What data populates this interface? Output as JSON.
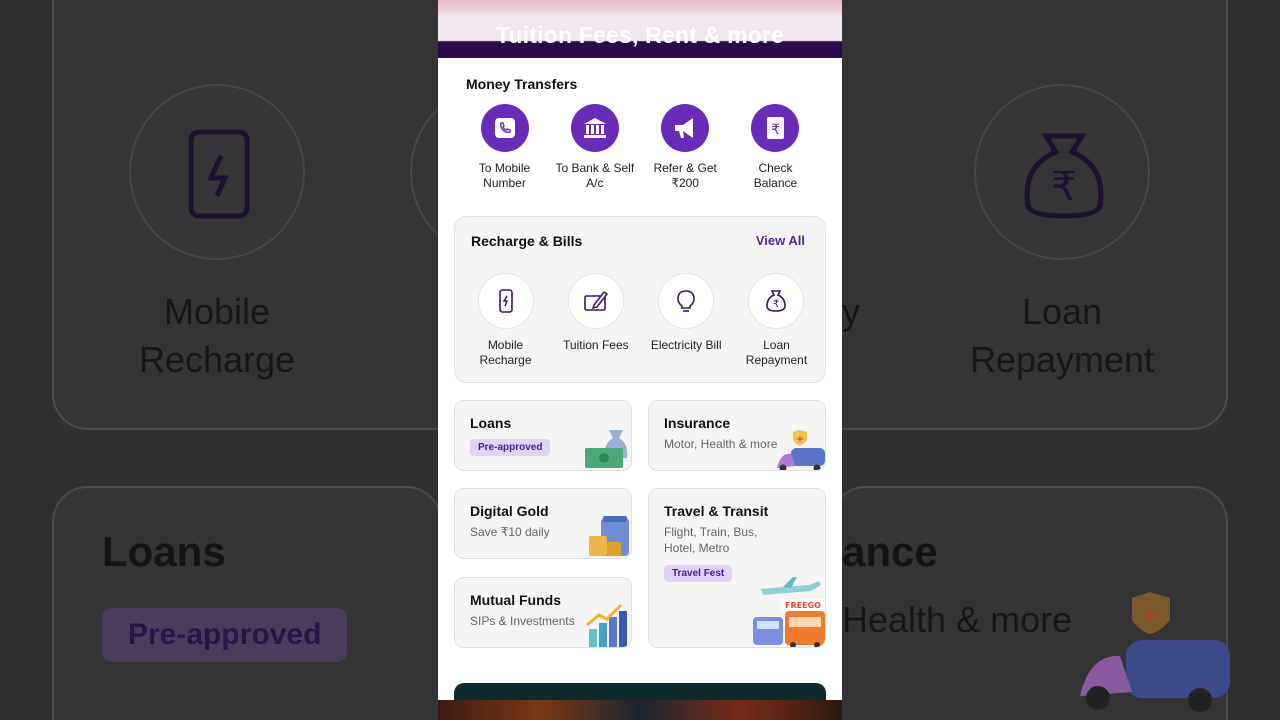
{
  "background": {
    "mobile_recharge_label": "Mobile Recharge",
    "loan_repayment_label": "Loan Repayment",
    "partial_label": "y",
    "loans_label": "Loans",
    "preapproved_label": "Pre-approved",
    "insurance_partial": "ance",
    "insurance_sub_partial": "Health & more"
  },
  "banner": {
    "title": "Tuition Fees, Rent & more"
  },
  "money_transfers": {
    "title": "Money Transfers",
    "items": [
      {
        "label": "To Mobile Number",
        "icon": "phone-icon"
      },
      {
        "label": "To Bank & Self A/c",
        "icon": "bank-icon"
      },
      {
        "label": "Refer & Get ₹200",
        "icon": "megaphone-icon"
      },
      {
        "label": "Check Balance",
        "icon": "rupee-book-icon"
      }
    ]
  },
  "recharge_bills": {
    "title": "Recharge & Bills",
    "view_all": "View All",
    "items": [
      {
        "label": "Mobile Recharge",
        "icon": "mobile-charge-icon"
      },
      {
        "label": "Tuition Fees",
        "icon": "tuition-icon"
      },
      {
        "label": "Electricity Bill",
        "icon": "bulb-icon"
      },
      {
        "label": "Loan Repayment",
        "icon": "money-bag-icon"
      }
    ]
  },
  "tiles": {
    "loans": {
      "title": "Loans",
      "badge": "Pre-approved"
    },
    "insurance": {
      "title": "Insurance",
      "subtitle": "Motor, Health & more"
    },
    "digital_gold": {
      "title": "Digital Gold",
      "subtitle": "Save ₹10 daily"
    },
    "travel": {
      "title": "Travel & Transit",
      "subtitle_line1": "Flight, Train, Bus,",
      "subtitle_line2": "Hotel, Metro",
      "badge": "Travel Fest",
      "promo": "FREEGO"
    },
    "mutual_funds": {
      "title": "Mutual Funds",
      "subtitle": "SIPs & Investments"
    }
  },
  "colors": {
    "brand_purple": "#6a2cb8",
    "link_purple": "#5c22a8",
    "badge_bg": "#e2d2f7"
  }
}
